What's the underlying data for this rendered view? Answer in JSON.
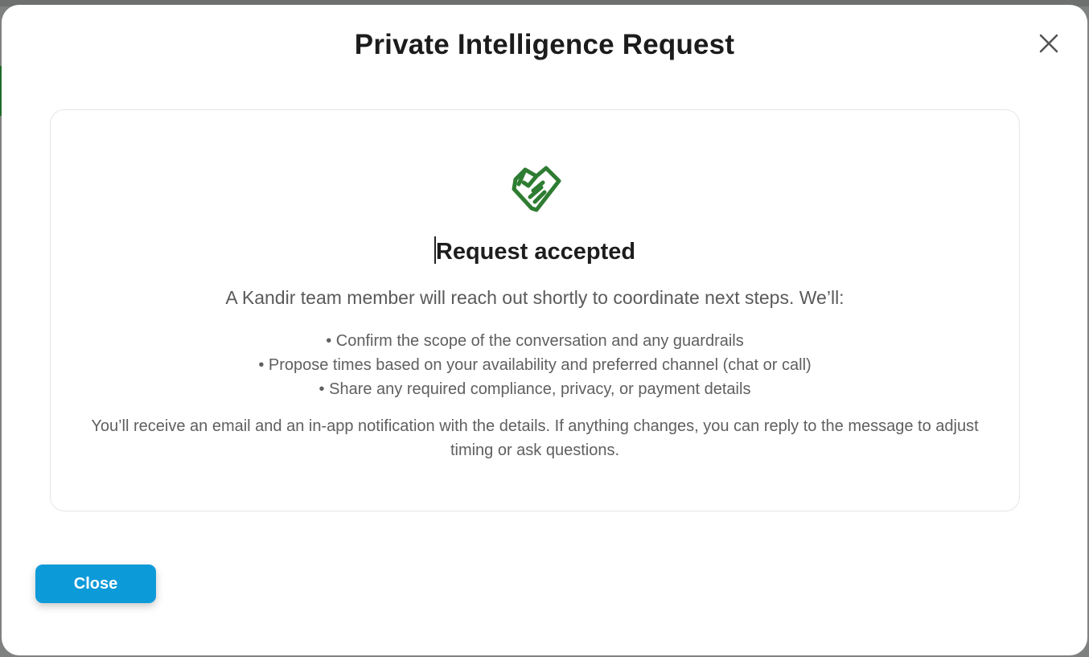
{
  "modal": {
    "title": "Private Intelligence Request",
    "close_icon": "close-icon"
  },
  "card": {
    "icon": "handshake-icon",
    "icon_color": "#2e7d32",
    "heading": "Request accepted",
    "intro": "A Kandir team member will reach out shortly to coordinate next steps. We’ll:",
    "bullets": [
      "• Confirm the scope of the conversation and any guardrails",
      "• Propose times based on your availability and preferred channel (chat or call)",
      "• Share any required compliance, privacy, or payment details"
    ],
    "closing": "You’ll receive an email and an in-app notification with the details. If anything changes, you can reply to the message to adjust timing or ask questions."
  },
  "footer": {
    "close_label": "Close",
    "button_color": "#0d9ad9"
  }
}
